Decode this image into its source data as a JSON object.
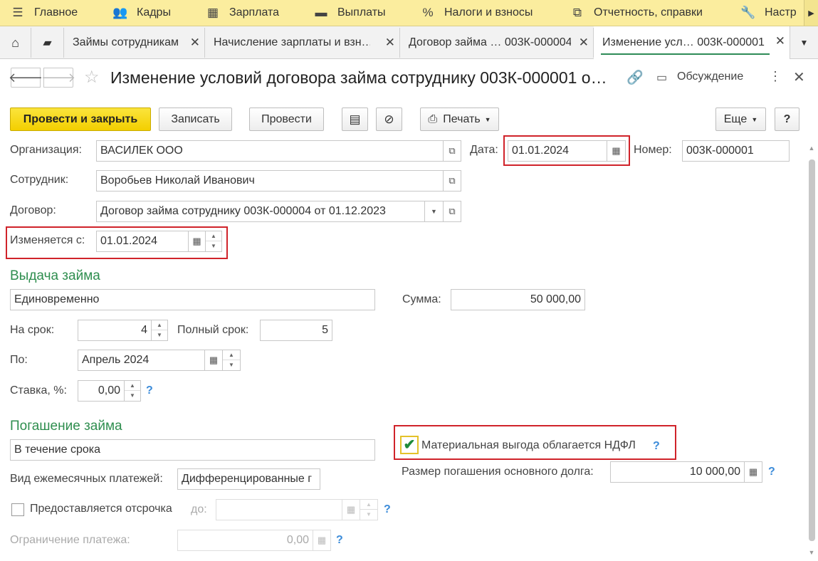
{
  "menu": {
    "items": [
      {
        "icon": "hamburger-icon",
        "glyph": "☰",
        "label": "Главное"
      },
      {
        "icon": "people-icon",
        "glyph": "👥",
        "label": "Кадры"
      },
      {
        "icon": "calculator-icon",
        "glyph": "▦",
        "label": "Зарплата"
      },
      {
        "icon": "wallet-icon",
        "glyph": "▬",
        "label": "Выплаты"
      },
      {
        "icon": "percent-icon",
        "glyph": "%",
        "label": "Налоги и взносы"
      },
      {
        "icon": "reports-icon",
        "glyph": "⧉",
        "label": "Отчетность, справки"
      },
      {
        "icon": "wrench-icon",
        "glyph": "🔧",
        "label": "Настр"
      }
    ]
  },
  "tabs": [
    {
      "label": "Займы сотрудникам"
    },
    {
      "label": "Начисление зарплаты и взн…"
    },
    {
      "label": "Договор займа … 003К-000004"
    },
    {
      "label": "Изменение усл… 003К-000001"
    }
  ],
  "document": {
    "title": "Изменение условий договора займа сотруднику 003К-000001 о…",
    "discussion_label": "Обсуждение"
  },
  "toolbar": {
    "post_close_label": "Провести и закрыть",
    "save_label": "Записать",
    "post_label": "Провести",
    "print_label": "Печать",
    "more_label": "Еще",
    "help_label": "?"
  },
  "form": {
    "organization_label": "Организация:",
    "organization_value": "ВАСИЛЕК ООО",
    "date_label": "Дата:",
    "date_value": "01.01.2024",
    "number_label": "Номер:",
    "number_value": "003К-000001",
    "employee_label": "Сотрудник:",
    "employee_value": "Воробьев Николай Иванович",
    "contract_label": "Договор:",
    "contract_value": "Договор займа сотруднику 003К-000004 от 01.12.2023",
    "changed_from_label": "Изменяется с:",
    "changed_from_value": "01.01.2024"
  },
  "issuance": {
    "section_title": "Выдача займа",
    "method_value": "Единовременно",
    "amount_label": "Сумма:",
    "amount_value": "50 000,00",
    "term_label": "На срок:",
    "term_value": "4",
    "full_term_label": "Полный срок:",
    "full_term_value": "5",
    "until_label": "По:",
    "until_value": "Апрель 2024",
    "rate_label": "Ставка, %:",
    "rate_value": "0,00",
    "help": "?"
  },
  "repayment": {
    "section_title": "Погашение займа",
    "method_value": "В течение срока",
    "tax_benefit_label": "Материальная выгода облагается НДФЛ",
    "tax_benefit_checked": true,
    "monthly_type_label": "Вид ежемесячных платежей:",
    "monthly_type_value": "Дифференцированные г",
    "principal_label": "Размер погашения основного долга:",
    "principal_value": "10 000,00",
    "deferral_label": "Предоставляется отсрочка",
    "deferral_until_label": "до:",
    "deferral_until_value": "",
    "limit_label": "Ограничение платежа:",
    "limit_value": "0,00",
    "help": "?"
  },
  "colors": {
    "menu_bg": "#fbed9e",
    "primary_button": "#f3cf00",
    "section_green": "#2f8e4f",
    "highlight_red": "#d0232a",
    "help_blue": "#3b8bd9"
  }
}
